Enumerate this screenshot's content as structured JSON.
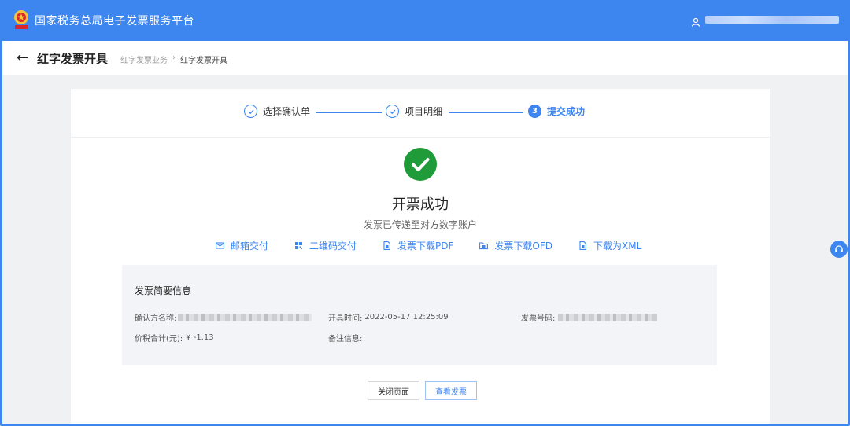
{
  "topbar": {
    "title": "国家税务总局电子发票服务平台",
    "icon": "emblem-logo",
    "user_icon": "user-icon"
  },
  "header": {
    "page_title": "红字发票开具",
    "breadcrumb": [
      "红字发票业务",
      "红字发票开具"
    ],
    "breadcrumb_separator": "›"
  },
  "steps": [
    {
      "label": "选择确认单",
      "state": "done"
    },
    {
      "label": "项目明细",
      "state": "done"
    },
    {
      "label": "提交成功",
      "state": "active",
      "number": "3"
    }
  ],
  "result": {
    "title": "开票成功",
    "subtitle": "发票已传递至对方数字账户"
  },
  "actions": [
    {
      "label": "邮箱交付",
      "icon": "mail-icon"
    },
    {
      "label": "二维码交付",
      "icon": "qrcode-icon"
    },
    {
      "label": "发票下载PDF",
      "icon": "document-icon"
    },
    {
      "label": "发票下载OFD",
      "icon": "folder-icon"
    },
    {
      "label": "下载为XML",
      "icon": "document-icon"
    }
  ],
  "info": {
    "title": "发票简要信息",
    "buyer_label": "确认方名称:",
    "time_label": "开具时间:",
    "time_value": "2022-05-17 12:25:09",
    "number_label": "发票号码:",
    "total_label": "价税合计(元):",
    "total_value": "¥ -1.13",
    "remark_label": "备注信息:"
  },
  "buttons": {
    "close": "关闭页面",
    "view": "查看发票"
  },
  "colors": {
    "primary": "#3d86f0",
    "success": "#1f9b3a"
  }
}
